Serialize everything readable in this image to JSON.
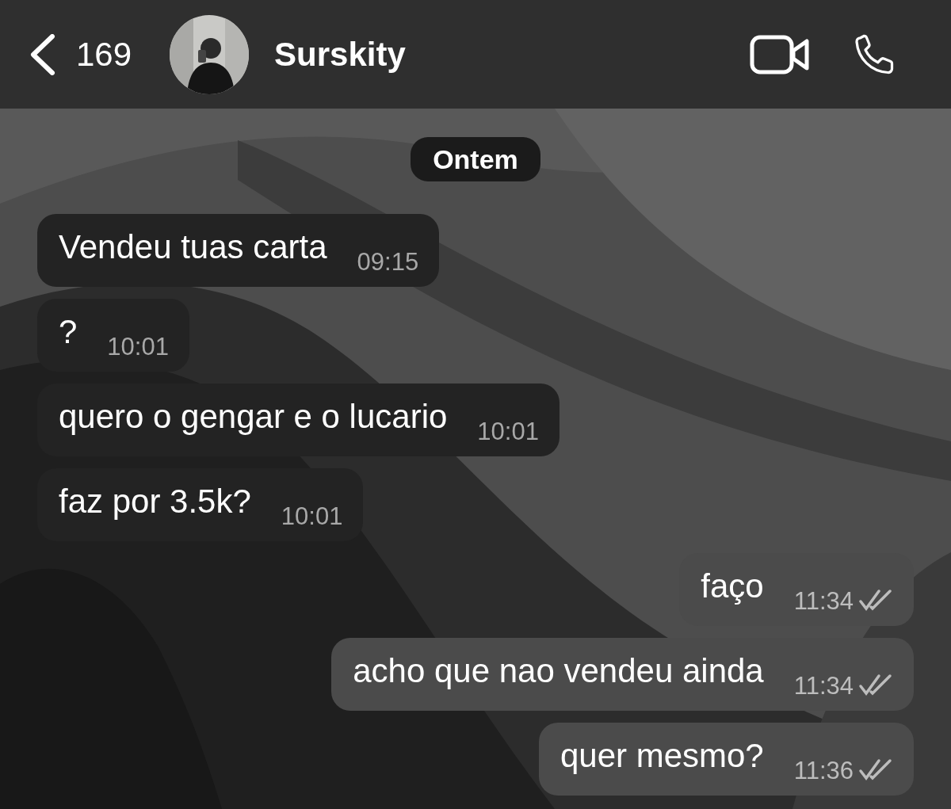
{
  "header": {
    "back_count": "169",
    "contact_name": "Surskity"
  },
  "date_label": "Ontem",
  "messages": [
    {
      "kind": "incoming",
      "text": "Vendeu tuas carta",
      "time": "09:15"
    },
    {
      "kind": "incoming",
      "text": "?",
      "time": "10:01"
    },
    {
      "kind": "incoming",
      "text": "quero o gengar e o lucario",
      "time": "10:01"
    },
    {
      "kind": "incoming",
      "text": "faz por 3.5k?",
      "time": "10:01"
    },
    {
      "kind": "outgoing",
      "text": "faço",
      "time": "11:34",
      "read": true
    },
    {
      "kind": "outgoing",
      "text": "acho que nao vendeu ainda",
      "time": "11:34",
      "read": true
    },
    {
      "kind": "outgoing",
      "text": "quer mesmo?",
      "time": "11:36",
      "read": true
    }
  ]
}
